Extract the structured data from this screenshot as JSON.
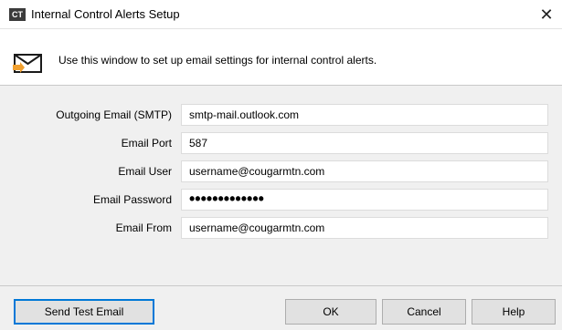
{
  "window": {
    "app_icon_text": "CT",
    "title": "Internal Control Alerts Setup",
    "close_glyph": "✕"
  },
  "header": {
    "icon": "envelope-icon",
    "description": "Use this window to set up email settings for internal control alerts."
  },
  "form": {
    "smtp_label": "Outgoing Email (SMTP)",
    "smtp_value": "smtp-mail.outlook.com",
    "port_label": "Email Port",
    "port_value": "587",
    "user_label": "Email User",
    "user_value": "username@cougarmtn.com",
    "password_label": "Email Password",
    "password_value": "•••••••••••••",
    "from_label": "Email From",
    "from_value": "username@cougarmtn.com"
  },
  "buttons": {
    "send_test": "Send Test Email",
    "ok": "OK",
    "cancel": "Cancel",
    "help": "Help"
  },
  "colors": {
    "focus_border": "#0078d7",
    "envelope_accent": "#f0a030"
  }
}
